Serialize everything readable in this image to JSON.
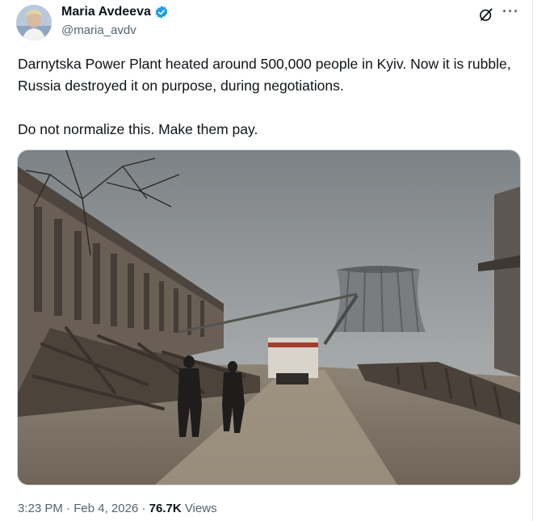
{
  "author": {
    "display_name": "Maria Avdeeva",
    "handle": "@maria_avdv",
    "verified_color": "#1d9bf0"
  },
  "header_icons": {
    "grok": "grok-icon",
    "more": "more-options-icon",
    "more_glyph": "···"
  },
  "tweet": {
    "paragraph_1": "Darnytska Power Plant heated around 500,000 people in Kyiv. Now it is rubble, Russia destroyed it on purpose, during negotiations.",
    "paragraph_2": "Do not normalize this. Make them pay."
  },
  "meta": {
    "time": "3:23 PM",
    "separator": " · ",
    "date": "Feb 4, 2026",
    "views_count": "76.7K",
    "views_label": " Views"
  }
}
